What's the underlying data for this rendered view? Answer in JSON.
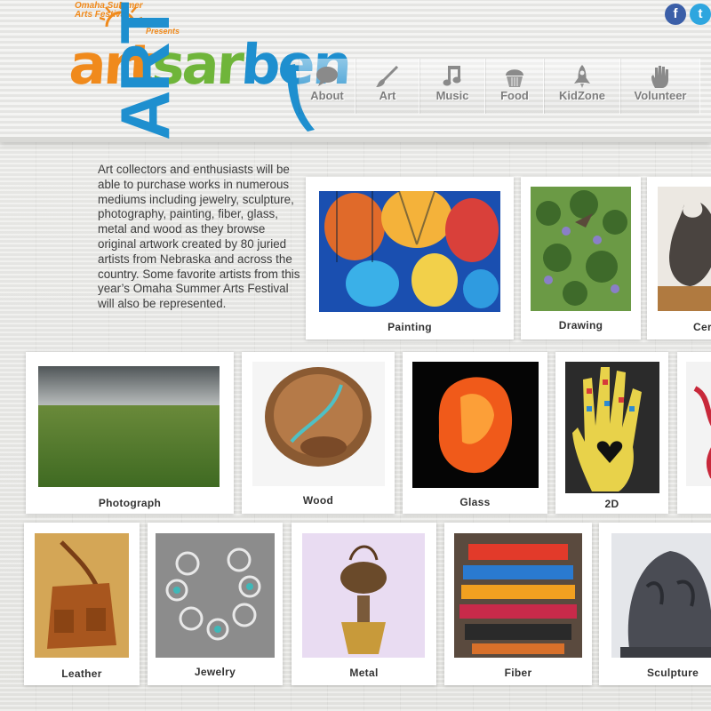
{
  "logo": {
    "festival": "Omaha Summer Arts Festival",
    "presents": "Presents",
    "word_part1": "art",
    "word_part2": "sar",
    "word_part3": "ben"
  },
  "social": {
    "facebook": "f",
    "twitter": "t"
  },
  "nav": [
    {
      "label": "About",
      "icon": "speech-bubble-icon"
    },
    {
      "label": "Art",
      "icon": "paintbrush-icon"
    },
    {
      "label": "Music",
      "icon": "music-note-icon"
    },
    {
      "label": "Food",
      "icon": "cupcake-icon"
    },
    {
      "label": "KidZone",
      "icon": "rocket-icon"
    },
    {
      "label": "Volunteer",
      "icon": "hand-icon"
    }
  ],
  "page": {
    "title": "ART",
    "intro": "Art collectors and enthusiasts will be able to purchase works in numerous mediums including jewelry, sculpture, photography, painting, fiber, glass, metal and wood as they browse original artwork created by 80 juried artists from Nebraska and across the country. Some favorite artists from this year’s Omaha Summer Arts Festival will also be represented."
  },
  "categories": {
    "painting": "Painting",
    "drawing": "Drawing",
    "ceramics": "Cer",
    "photograph": "Photograph",
    "wood": "Wood",
    "glass": "Glass",
    "twod": "2D",
    "leather": "Leather",
    "jewelry": "Jewelry",
    "metal": "Metal",
    "fiber": "Fiber",
    "sculpture": "Sculpture"
  },
  "colors": {
    "orange": "#f08a1c",
    "green": "#6fb53a",
    "blue": "#1e8fcf"
  }
}
